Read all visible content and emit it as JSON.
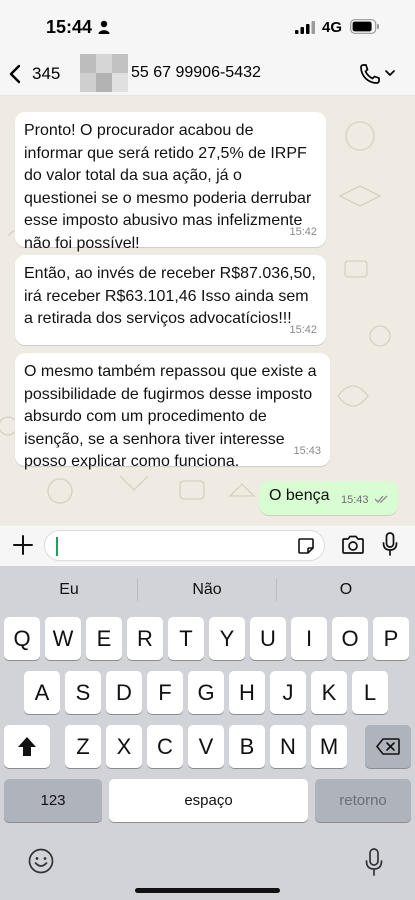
{
  "status_bar": {
    "time": "15:44",
    "network": "4G"
  },
  "header": {
    "back_count": "345",
    "contact_name": "55 67 99906-5432"
  },
  "messages": [
    {
      "text": "Pronto! O procurador acabou de informar que será retido 27,5% de IRPF do valor total da  sua ação, já o questionei se o mesmo poderia derrubar esse imposto abusivo mas infelizmente não foi possível!",
      "time": "15:42"
    },
    {
      "text": "Então, ao invés de receber R$87.036,50, irá receber  R$63.101,46 Isso ainda sem a retirada dos serviços advocatícios!!!",
      "time": "15:42"
    },
    {
      "text": "O mesmo também repassou que existe a possibilidade de fugirmos desse imposto absurdo com um procedimento de isenção, se a senhora tiver interesse posso explicar como funciona.",
      "time": "15:43"
    }
  ],
  "outgoing": {
    "text": "O bença",
    "time": "15:43",
    "status": "delivered"
  },
  "input": {
    "value": ""
  },
  "suggestions": [
    "Eu",
    "Não",
    "O"
  ],
  "keyboard": {
    "row1": [
      "Q",
      "W",
      "E",
      "R",
      "T",
      "Y",
      "U",
      "I",
      "O",
      "P"
    ],
    "row2": [
      "A",
      "S",
      "D",
      "F",
      "G",
      "H",
      "J",
      "K",
      "L"
    ],
    "row3": [
      "Z",
      "X",
      "C",
      "V",
      "B",
      "N",
      "M"
    ],
    "numbers_label": "123",
    "space_label": "espaço",
    "return_label": "retorno"
  },
  "colors": {
    "outgoing_bubble": "#d9fdd3",
    "chat_bg": "#efeae2",
    "accent": "#1aa35a"
  }
}
